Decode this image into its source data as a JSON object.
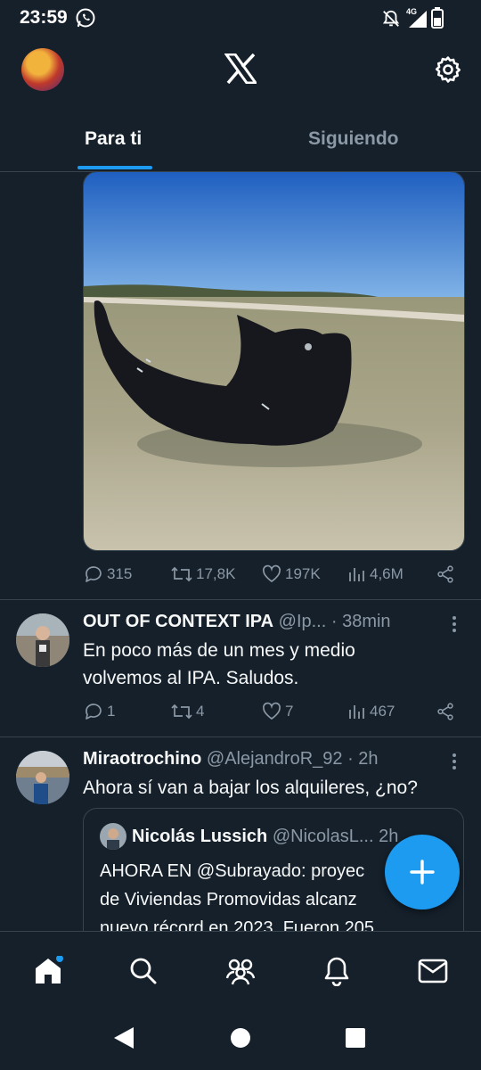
{
  "status_bar": {
    "time": "23:59",
    "network": "4G"
  },
  "tabs": {
    "for_you": "Para ti",
    "following": "Siguiendo"
  },
  "tweet1": {
    "stats": {
      "replies": "315",
      "retweets": "17,8K",
      "likes": "197K",
      "views": "4,6M"
    }
  },
  "tweet2": {
    "name": "OUT OF CONTEXT IPA",
    "handle": "@Ip...",
    "time": "· 38min",
    "text_line1": "En poco más de un mes y medio",
    "text_line2": "volvemos al IPA. Saludos.",
    "stats": {
      "replies": "1",
      "retweets": "4",
      "likes": "7",
      "views": "467"
    }
  },
  "tweet3": {
    "name": "Miraotrochino",
    "handle": "@AlejandroR_92",
    "time": "· 2h",
    "text": "Ahora sí van a bajar los alquileres, ¿no?",
    "quote": {
      "name": "Nicolás Lussich",
      "handle": "@NicolasL...",
      "time": "2h",
      "line1": "AHORA EN @Subrayado: proyec",
      "line2": "de Viviendas Promovidas alcanz",
      "line3": "nuevo récord en 2023. Fueron 205"
    }
  },
  "colors": {
    "background": "#15202b",
    "accent": "#1d9bf0",
    "muted": "#8b98a5",
    "border": "#38444d"
  },
  "icons": [
    "whatsapp-icon",
    "mute-icon",
    "signal-icon",
    "battery-icon",
    "x-logo-icon",
    "gear-icon",
    "reply-icon",
    "retweet-icon",
    "like-icon",
    "views-icon",
    "share-icon",
    "more-icon",
    "compose-plus-icon",
    "home-icon",
    "search-icon",
    "communities-icon",
    "notifications-icon",
    "messages-icon",
    "back-icon",
    "home-circle-icon",
    "recents-icon"
  ]
}
